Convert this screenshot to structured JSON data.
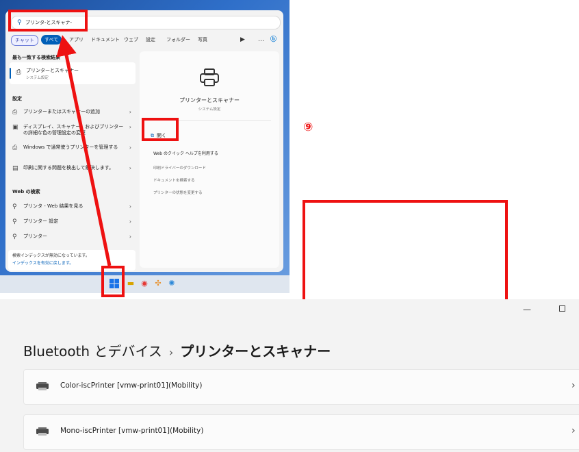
{
  "start_menu": {
    "search_query": "プリンタ-とスキャナ-",
    "filters": [
      "チャット",
      "すべて",
      "アプリ",
      "ドキュメント",
      "ウェブ",
      "設定",
      "フォルダー",
      "写真"
    ],
    "best_match_header": "最も一致する検索結果",
    "best_match_title": "プリンターとスキャナー",
    "best_match_subtitle": "システム設定",
    "settings_header": "設定",
    "settings_items": [
      "プリンターまたはスキャナーの追加",
      "ディスプレイ、スキャナー、およびプリンターの詳細な色の管理設定の変更",
      "Windows で通常使うプリンターを管理する",
      "印刷に関する問題を検出して解決します。"
    ],
    "web_header": "Web の検索",
    "web_items": [
      "プリンタ - Web 結果を見る",
      "プリンター 設定",
      "プリンター"
    ],
    "index_notice_line1": "検索インデックスが無効になっています。",
    "index_notice_line2": "インデックスを有効に戻します。",
    "detail_title": "プリンターとスキャナー",
    "detail_subtitle": "システム設定",
    "open_label": "開く",
    "web_help": "Web のクイック ヘルプを利用する",
    "links": [
      "印刷ドライバーのダウンロード",
      "ドキュメントを検索する",
      "プリンターの状態を変更する"
    ]
  },
  "annotation": {
    "step_label": "⑨"
  },
  "settings": {
    "breadcrumb_parent": "Bluetooth とデバイス",
    "breadcrumb_separator": "›",
    "breadcrumb_current": "プリンターとスキャナー",
    "printers": [
      "Color-iscPrinter [vmw-print01](Mobility)",
      "Mono-iscPrinter [vmw-print01](Mobility)"
    ]
  },
  "colors": {
    "accent": "#005fb8",
    "annotation_red": "#ee1111"
  },
  "icons": [
    "search-icon",
    "printer-icon",
    "display-icon",
    "open-external-icon",
    "chevron-right-icon",
    "windows-start-icon"
  ]
}
